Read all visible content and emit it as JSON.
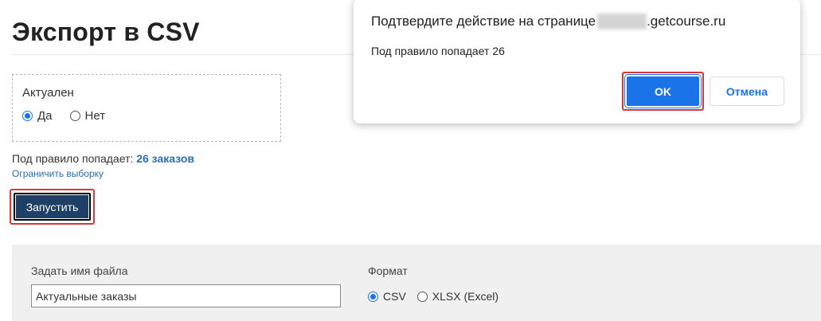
{
  "page": {
    "title": "Экспорт в CSV"
  },
  "filter": {
    "label": "Актуален",
    "options": [
      {
        "label": "Да",
        "checked": true
      },
      {
        "label": "Нет",
        "checked": false
      }
    ]
  },
  "matches": {
    "prefix": "Под правило попадает:",
    "count": "26 заказов",
    "limit_link": "Ограничить выборку"
  },
  "run_button": "Запустить",
  "settings": {
    "filename_label": "Задать имя файла",
    "filename_value": "Актуальные заказы",
    "format_label": "Формат",
    "format_options": [
      {
        "label": "CSV",
        "checked": true
      },
      {
        "label": "XLSX (Excel)",
        "checked": false
      }
    ]
  },
  "dialog": {
    "title_prefix": "Подтвердите действие на странице",
    "title_suffix": ".getcourse.ru",
    "message": "Под правило попадает 26",
    "ok_label": "OK",
    "cancel_label": "Отмена"
  },
  "colors": {
    "accent": "#1a73e8",
    "run_button": "#1e3f66",
    "highlight": "#d9383a",
    "link": "#2a6db5",
    "panel_bg": "#f0f0f0"
  }
}
